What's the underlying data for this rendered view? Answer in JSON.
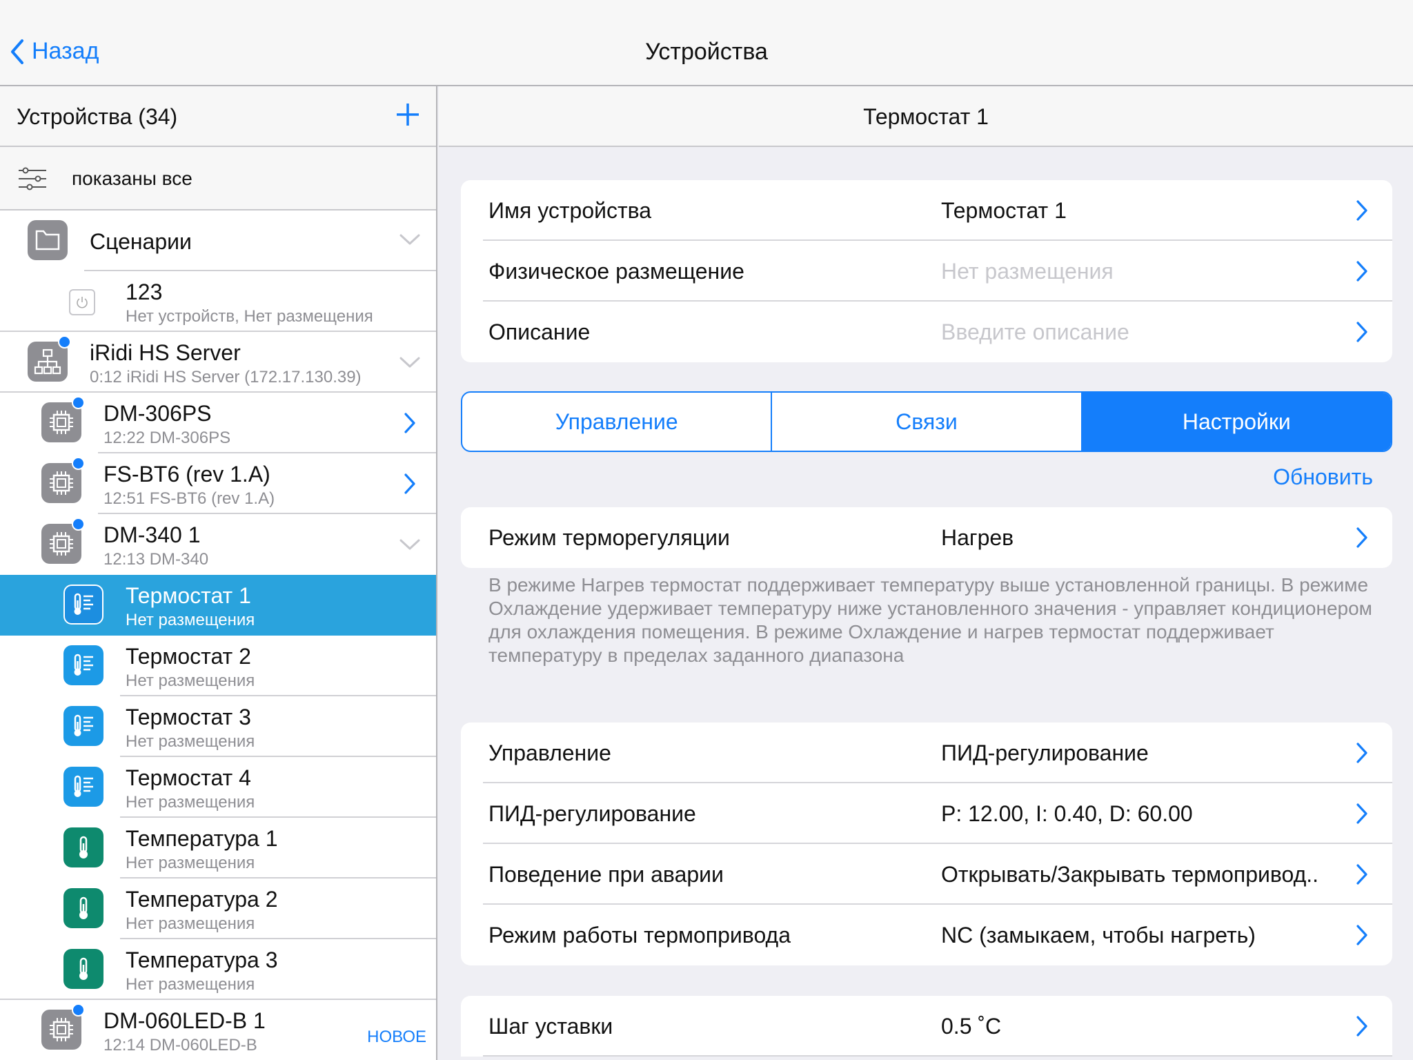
{
  "topbar": {
    "back": "Назад",
    "title": "Устройства"
  },
  "left": {
    "title": "Устройства (34)",
    "filter": "показаны все",
    "rows": [
      {
        "title": "Сценарии",
        "sub": ""
      },
      {
        "title": "123",
        "sub": "Нет устройств, Нет размещения"
      },
      {
        "title": "iRidi HS Server",
        "sub": "0:12 iRidi HS Server (172.17.130.39)"
      },
      {
        "title": "DM-306PS",
        "sub": "12:22 DM-306PS"
      },
      {
        "title": "FS-BT6 (rev 1.A)",
        "sub": "12:51 FS-BT6 (rev 1.A)"
      },
      {
        "title": "DM-340 1",
        "sub": "12:13 DM-340"
      },
      {
        "title": "Термостат 1",
        "sub": "Нет размещения"
      },
      {
        "title": "Термостат 2",
        "sub": "Нет размещения"
      },
      {
        "title": "Термостат 3",
        "sub": "Нет размещения"
      },
      {
        "title": "Термостат 4",
        "sub": "Нет размещения"
      },
      {
        "title": "Температура 1",
        "sub": "Нет размещения"
      },
      {
        "title": "Температура 2",
        "sub": "Нет размещения"
      },
      {
        "title": "Температура 3",
        "sub": "Нет размещения"
      },
      {
        "title": "DM-060LED-B 1",
        "sub": "12:14 DM-060LED-B",
        "badge": "НОВОЕ"
      }
    ]
  },
  "right": {
    "title": "Термостат 1",
    "info": [
      {
        "label": "Имя устройства",
        "value": "Термостат 1"
      },
      {
        "label": "Физическое размещение",
        "value": "Нет размещения"
      },
      {
        "label": "Описание",
        "value": "Введите описание"
      }
    ],
    "tabs": [
      "Управление",
      "Связи",
      "Настройки"
    ],
    "refresh": "Обновить",
    "mode": {
      "label": "Режим терморегуляции",
      "value": "Нагрев"
    },
    "note": "В режиме Нагрев термостат поддерживает температуру выше установленной границы. В режиме Охлаждение удерживает температуру ниже установленного значения - управляет кондиционером для охлаждения помещения. В режиме Охлаждение и нагрев термостат поддерживает температуру в пределах заданного диапазона",
    "control": [
      {
        "label": "Управление",
        "value": "ПИД-регулирование"
      },
      {
        "label": "ПИД-регулирование",
        "value": "P: 12.00, I: 0.40, D: 60.00"
      },
      {
        "label": "Поведение при аварии",
        "value": "Открывать/Закрывать термопривод.."
      },
      {
        "label": "Режим работы термопривода",
        "value": "NC (замыкаем, чтобы нагреть)"
      }
    ],
    "step": {
      "label": "Шаг уставки",
      "value": "0.5 ˚C"
    }
  }
}
